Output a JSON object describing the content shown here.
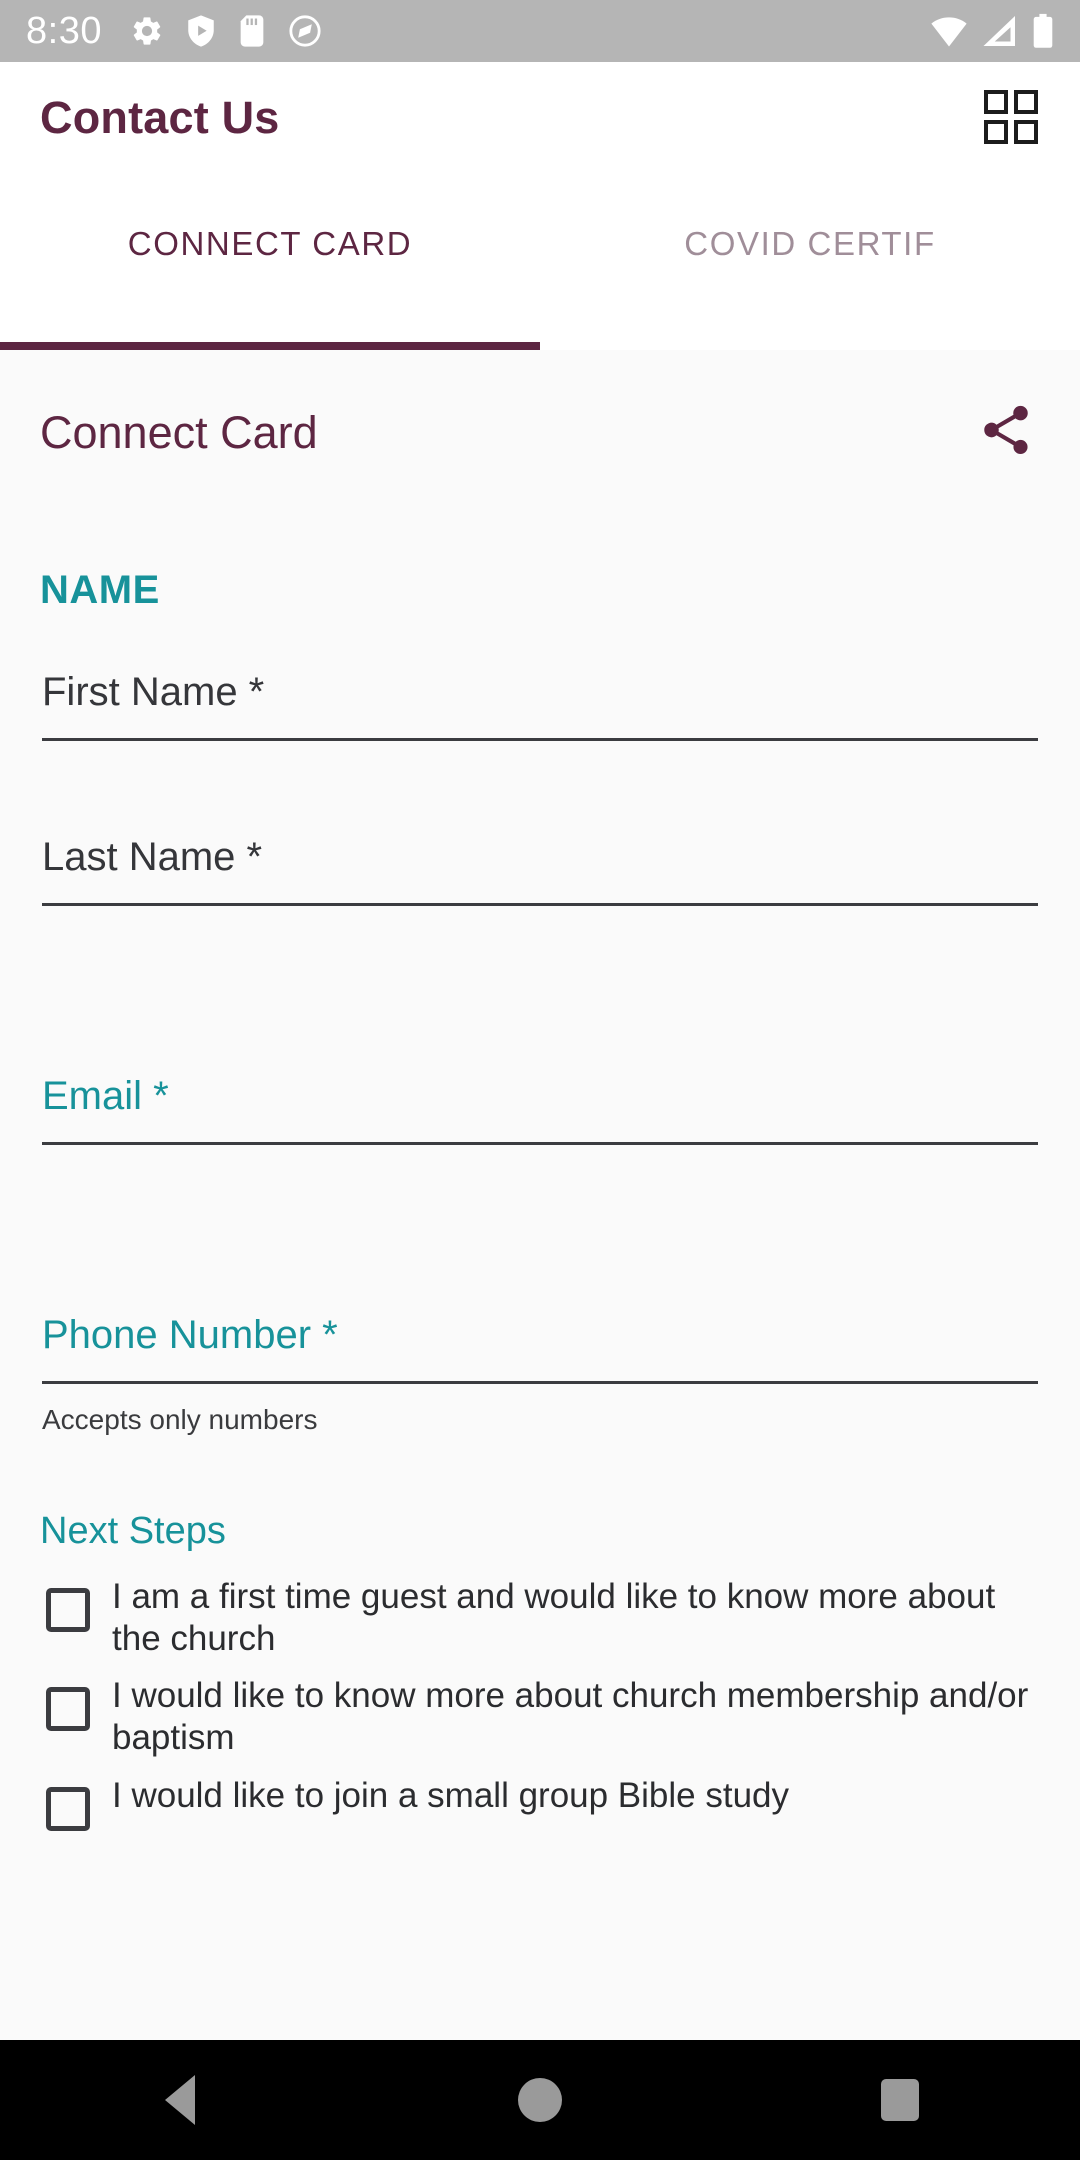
{
  "status_bar": {
    "time": "8:30",
    "left_icons": [
      "settings-gear-icon",
      "play-shield-icon",
      "sd-card-icon",
      "sync-circle-icon"
    ],
    "right_icons": [
      "wifi-icon",
      "cellular-signal-icon",
      "battery-icon"
    ],
    "background_color": "#b5b5b5"
  },
  "app_bar": {
    "title": "Contact Us",
    "grid_icon": "grid-view-icon",
    "title_color": "#5d2642"
  },
  "tabs": {
    "items": [
      {
        "label": "CONNECT CARD",
        "active": true
      },
      {
        "label": "COVID CERTIF",
        "active": false
      }
    ],
    "active_color": "#5d2642",
    "inactive_color": "#a08e99"
  },
  "card": {
    "title": "Connect Card",
    "share_icon": "share-icon"
  },
  "form": {
    "name_section_label": "NAME",
    "fields": [
      {
        "placeholder": "First Name *",
        "value": "",
        "style": "dark"
      },
      {
        "placeholder": "Last Name *",
        "value": "",
        "style": "dark"
      },
      {
        "placeholder": "Email *",
        "value": "",
        "style": "teal"
      },
      {
        "placeholder": "Phone Number *",
        "value": "",
        "style": "teal",
        "helper": "Accepts only numbers"
      }
    ],
    "accent_color": "#17929a"
  },
  "next_steps": {
    "label": "Next Steps",
    "options": [
      {
        "text": "I am a first time guest and would like to know more about the church",
        "checked": false
      },
      {
        "text": "I would like to know more about church membership and/or baptism",
        "checked": false
      },
      {
        "text": "I would like to join a small group Bible study",
        "checked": false
      }
    ]
  },
  "nav_bar": {
    "buttons": [
      "back-icon",
      "home-icon",
      "recents-icon"
    ]
  }
}
